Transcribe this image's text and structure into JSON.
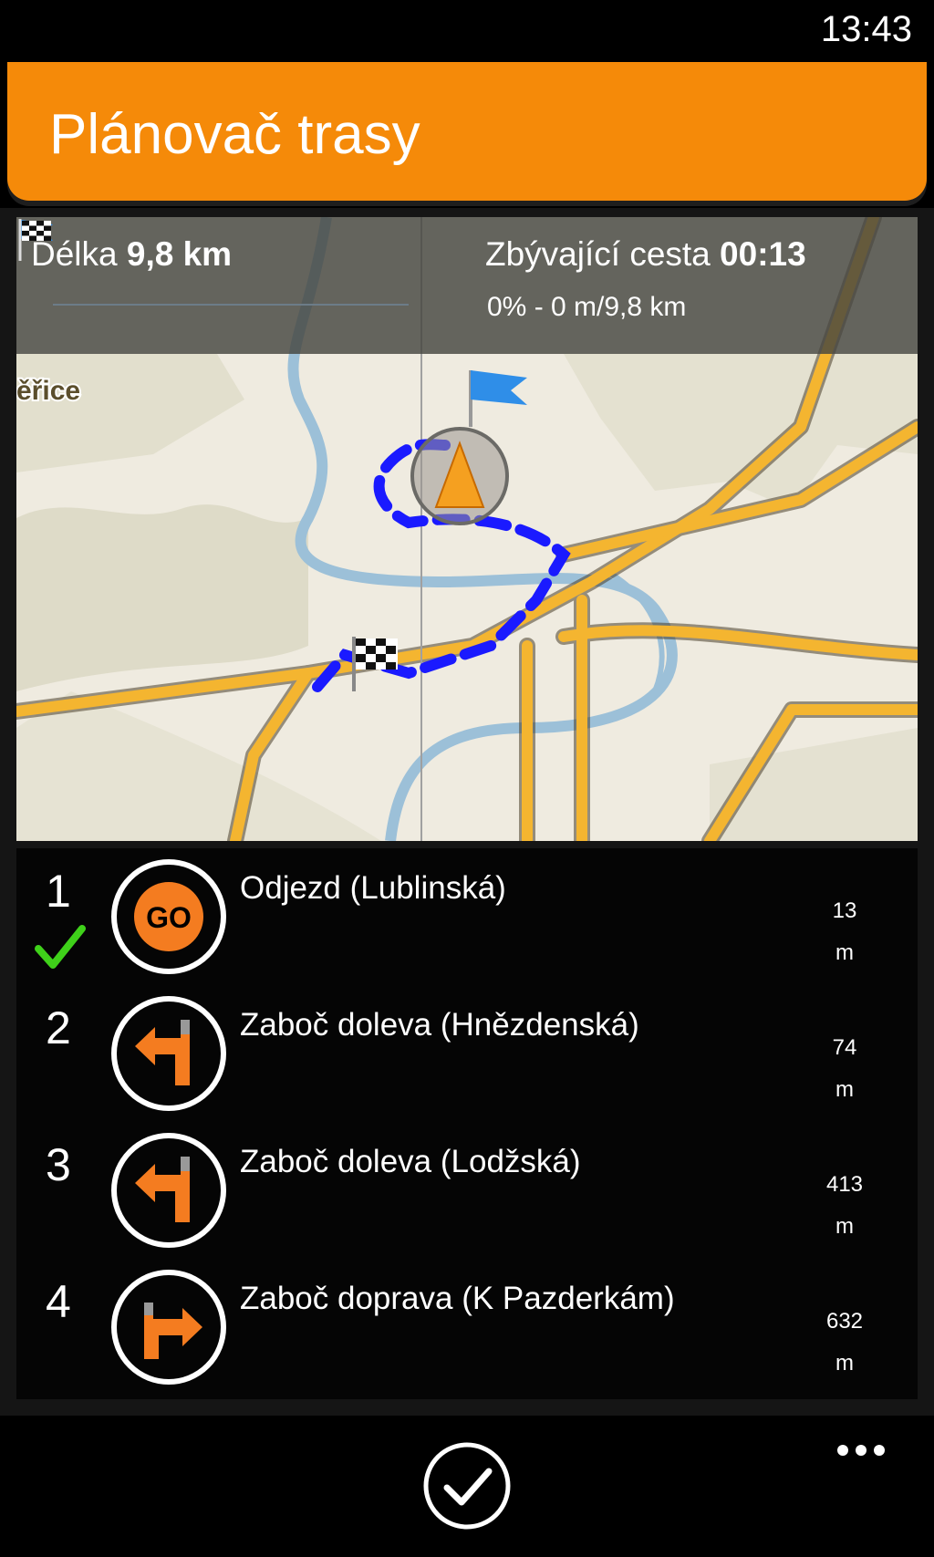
{
  "status_bar": {
    "time": "13:43"
  },
  "header": {
    "title": "Plánovač trasy"
  },
  "route_info": {
    "length_label": "Délka",
    "length_value": "9,8 km",
    "remaining_label": "Zbývající cesta",
    "remaining_value": "00:13",
    "progress_text": "0% - 0 m/9,8 km",
    "progress_fraction": 0.0
  },
  "map": {
    "place_label": "ěřice"
  },
  "steps": [
    {
      "number": "1",
      "text": "Odjezd (Lublinská)",
      "distance": "13",
      "unit": "m",
      "icon": "go-icon",
      "done": true
    },
    {
      "number": "2",
      "text": "Zaboč doleva (Hnězdenská)",
      "distance": "74",
      "unit": "m",
      "icon": "turn-left-icon",
      "done": false
    },
    {
      "number": "3",
      "text": "Zaboč doleva (Lodžská)",
      "distance": "413",
      "unit": "m",
      "icon": "turn-left-icon",
      "done": false
    },
    {
      "number": "4",
      "text": "Zaboč doprava (K Pazderkám)",
      "distance": "632",
      "unit": "m",
      "icon": "turn-right-icon",
      "done": false
    }
  ],
  "go_icon_text": "GO",
  "appbar": {
    "confirm_icon": "check-circle-icon",
    "more_icon": "more-icon"
  },
  "colors": {
    "accent": "#f58a09",
    "route": "#1a1aff",
    "road": "#f4b530",
    "check": "#3fd11a"
  }
}
